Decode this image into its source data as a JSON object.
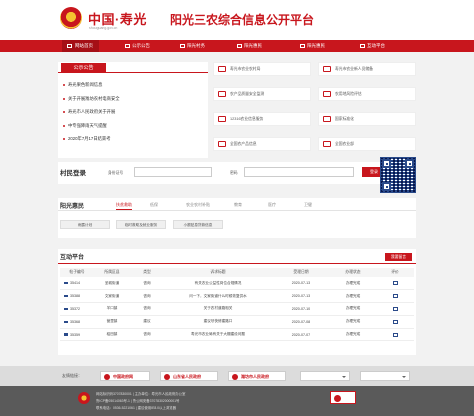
{
  "header": {
    "logo_text": "中国·寿光",
    "logo_sub": "shouguang.gov.cn",
    "site_title": "阳光三农综合信息公开平台"
  },
  "nav": [
    {
      "label": "网站首页",
      "icon": "home-icon"
    },
    {
      "label": "公示公告",
      "icon": "notice-icon"
    },
    {
      "label": "阳光村务",
      "icon": "village-icon"
    },
    {
      "label": "阳光惠民",
      "icon": "benefit-icon"
    },
    {
      "label": "阳光惠民",
      "icon": "people-icon"
    },
    {
      "label": "互动平台",
      "icon": "chat-icon"
    }
  ],
  "notice": {
    "tab": "公示公告",
    "items": [
      "寿光果色新闻信息",
      "关于开展潍坊农村电商安全",
      "寿光市人民政府关于开展",
      "中专强降雨天气提醒",
      "2020年7月17日结束考"
    ]
  },
  "services": [
    "寿光市农业农村局",
    "寿光市农业新人员储备",
    "农产品质量安全监测",
    "农用地风险评估",
    "12316农业信息服务",
    "国家标准化",
    "全国农产品信息",
    "全国农业部"
  ],
  "login": {
    "title": "村民登录",
    "id_label": "身份证号",
    "pwd_label": "密码",
    "button": "登录"
  },
  "benefit": {
    "title": "阳光惠民",
    "tabs": [
      "扶贫救助",
      "低保",
      "农业农村补贴",
      "教育",
      "医疗",
      "卫健"
    ],
    "items": [
      "雨露计划",
      "临时救助及就业服务",
      "小额贴息贷款信息"
    ]
  },
  "interact": {
    "title": "互动平台",
    "button": "我要留言",
    "columns": [
      "帖子编号",
      "所属区县",
      "类型",
      "诉求标题",
      "受理日期",
      "办理状态",
      "评价"
    ],
    "rows": [
      [
        "35414",
        "圣城街道",
        "咨询",
        "有关农业公益性岗位合规情况",
        "2020-07-13",
        "办理完成"
      ],
      [
        "35388",
        "文家街道",
        "咨询",
        "问一下，文家街道什么时候恢复供水",
        "2020-07-13",
        "办理完成"
      ],
      [
        "35372",
        "羊口镇",
        "咨询",
        "关于农村道路相关",
        "2020-07-10",
        "办理完成"
      ],
      [
        "35368",
        "营里镇",
        "建议",
        "建议尽快修建路口",
        "2020-07-08",
        "办理完成"
      ],
      [
        "35359",
        "稻田镇",
        "咨询",
        "寿光市农业局有关于大棚建设问题",
        "2020-07-07",
        "办理完成"
      ]
    ]
  },
  "links": {
    "label": "友情链接：",
    "badges": [
      "中国政府网",
      "山东省人民政府",
      "潍坊市人民政府"
    ]
  },
  "footer": {
    "lines": [
      "网站标识码3707830001 | 主办单位：寿光市人民政府办公室",
      "鲁ICP备05014063号-1 | 鲁公网安备37078302000001号",
      "联系电话：0536-5221061 | 建议使用IE8.0以上浏览器"
    ]
  }
}
